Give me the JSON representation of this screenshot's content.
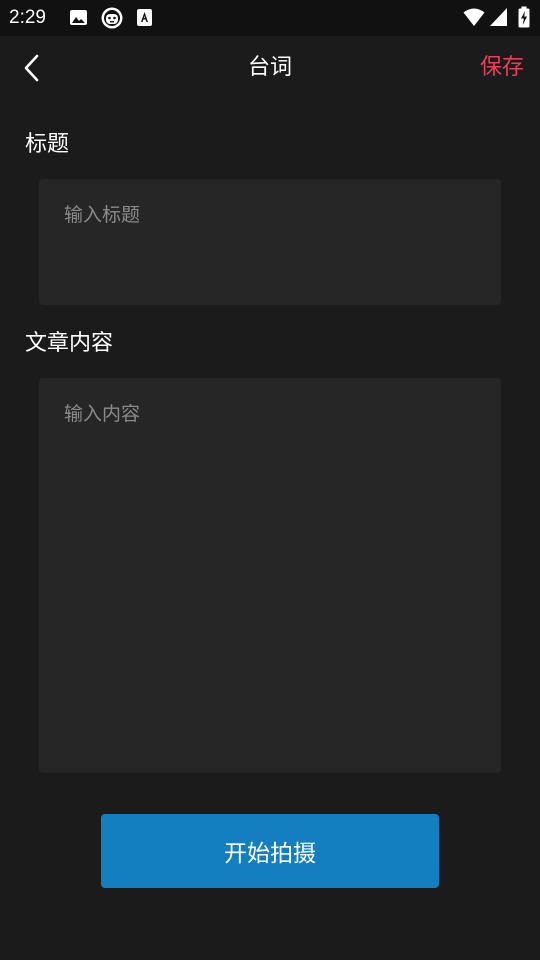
{
  "status_bar": {
    "time": "2:29",
    "icons": [
      "image-icon",
      "android-robot-icon",
      "font-a-icon",
      "wifi-icon",
      "cellular-signal-icon",
      "battery-charging-icon"
    ]
  },
  "header": {
    "title": "台词",
    "back_icon": "chevron-left-icon",
    "save_label": "保存"
  },
  "title_section": {
    "label": "标题",
    "placeholder": "输入标题",
    "value": ""
  },
  "content_section": {
    "label": "文章内容",
    "placeholder": "输入内容",
    "value": ""
  },
  "actions": {
    "start_recording_label": "开始拍摄"
  },
  "colors": {
    "background": "#1b1b1b",
    "status_bar": "#111111",
    "input_background": "#262626",
    "accent_save": "#e8405a",
    "primary_button": "#137fc0",
    "placeholder": "#8a8a8a"
  }
}
